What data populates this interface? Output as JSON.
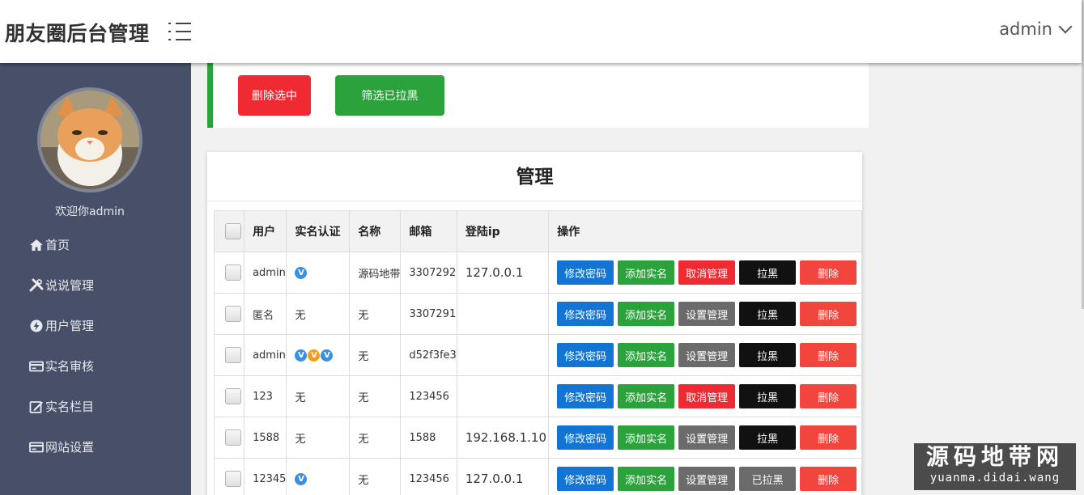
{
  "header": {
    "title": "朋友圈后台管理",
    "user": "admin"
  },
  "sidebar": {
    "welcome": "欢迎你admin",
    "items": [
      {
        "label": "首页",
        "icon": "home-icon"
      },
      {
        "label": "说说管理",
        "icon": "tools-icon"
      },
      {
        "label": "用户管理",
        "icon": "bolt-icon"
      },
      {
        "label": "实名审核",
        "icon": "card-icon"
      },
      {
        "label": "实名栏目",
        "icon": "edit-icon"
      },
      {
        "label": "网站设置",
        "icon": "card-icon"
      }
    ]
  },
  "toolbar": {
    "delete_selected": "删除选中",
    "filter_blacklisted": "筛选已拉黑"
  },
  "card": {
    "title": "管理"
  },
  "table": {
    "headers": [
      "用户",
      "实名认证",
      "名称",
      "邮箱",
      "登陆ip",
      "操作"
    ],
    "rows": [
      {
        "user": "admin",
        "badges": [
          "blue"
        ],
        "cert": "",
        "name": "源码地带",
        "email": "3307292",
        "ip": "127.0.0.1",
        "ops": [
          "修改密码",
          "添加实名",
          "取消管理",
          "拉黑",
          "删除"
        ]
      },
      {
        "user": "匿名",
        "badges": [],
        "cert": "无",
        "name": "无",
        "email": "3307291",
        "ip": "",
        "ops": [
          "修改密码",
          "添加实名",
          "设置管理",
          "拉黑",
          "删除"
        ]
      },
      {
        "user": "admin",
        "badges": [
          "blue",
          "orange",
          "blue"
        ],
        "cert": "",
        "name": "无",
        "email": "d52f3fe3",
        "ip": "",
        "ops": [
          "修改密码",
          "添加实名",
          "设置管理",
          "拉黑",
          "删除"
        ]
      },
      {
        "user": "123",
        "badges": [],
        "cert": "无",
        "name": "无",
        "email": "123456",
        "ip": "",
        "ops": [
          "修改密码",
          "添加实名",
          "取消管理",
          "拉黑",
          "删除"
        ]
      },
      {
        "user": "1588",
        "badges": [],
        "cert": "无",
        "name": "无",
        "email": "1588",
        "ip": "192.168.1.10",
        "ops": [
          "修改密码",
          "添加实名",
          "设置管理",
          "拉黑",
          "删除"
        ]
      },
      {
        "user": "12345",
        "badges": [
          "blue"
        ],
        "cert": "",
        "name": "无",
        "email": "123456",
        "ip": "127.0.0.1",
        "ops": [
          "修改密码",
          "添加实名",
          "设置管理",
          "已拉黑",
          "删除"
        ]
      }
    ]
  },
  "colors": {
    "sidebar_bg": "#475068",
    "danger": "#ef2a33",
    "success": "#2ca23c",
    "primary": "#1474d4",
    "gray": "#6b6b6b",
    "black": "#111111",
    "delete": "#f1453d",
    "badge_blue": "#3b8fe0",
    "badge_orange": "#f39c1f"
  },
  "watermark": {
    "cn": "源码地带网",
    "en": "yuanma.didai.wang"
  }
}
